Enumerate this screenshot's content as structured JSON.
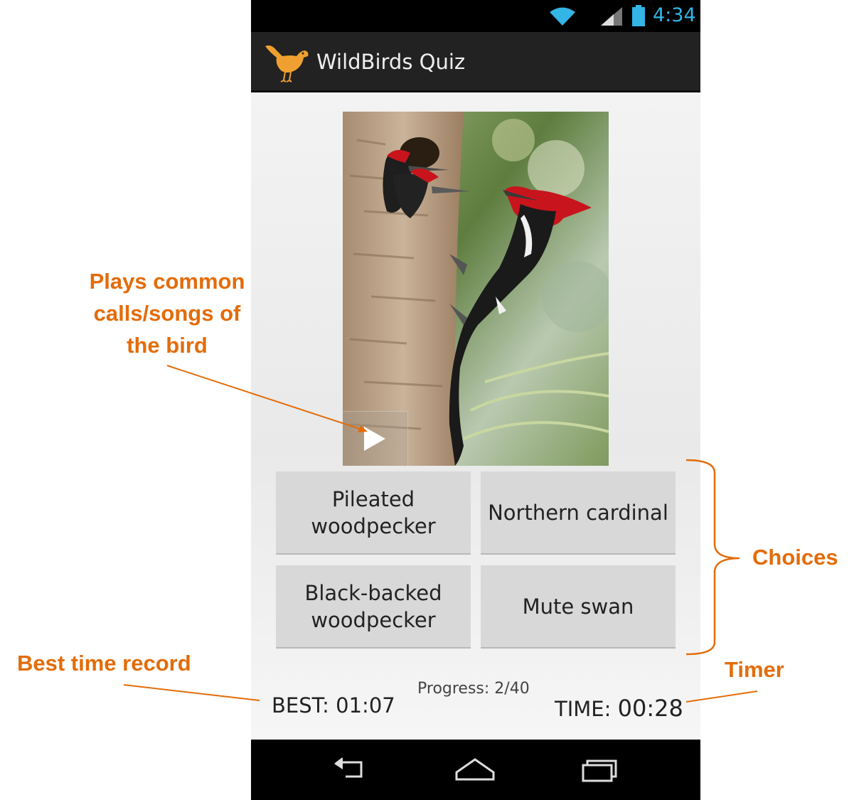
{
  "status_bar": {
    "time": "4:34",
    "icons": [
      "wifi-icon",
      "signal-icon",
      "battery-icon"
    ],
    "accent_color": "#33b5e5"
  },
  "action_bar": {
    "title": "WildBirds Quiz",
    "logo_icon": "bird-logo-icon"
  },
  "quiz": {
    "play_icon": "play-icon",
    "choices": [
      "Pileated woodpecker",
      "Northern cardinal",
      "Black-backed woodpecker",
      "Mute swan"
    ],
    "progress": "Progress: 2/40",
    "best_label": "BEST:",
    "best_value": "01:07",
    "time_label": "TIME:",
    "time_value": "00:28"
  },
  "nav_bar": {
    "icons": [
      "back-icon",
      "home-icon",
      "recent-apps-icon"
    ]
  },
  "annotations": {
    "plays": "Plays common calls/songs of the bird",
    "choices": "Choices",
    "best": "Best time record",
    "timer": "Timer",
    "color": "#e36c0a"
  }
}
